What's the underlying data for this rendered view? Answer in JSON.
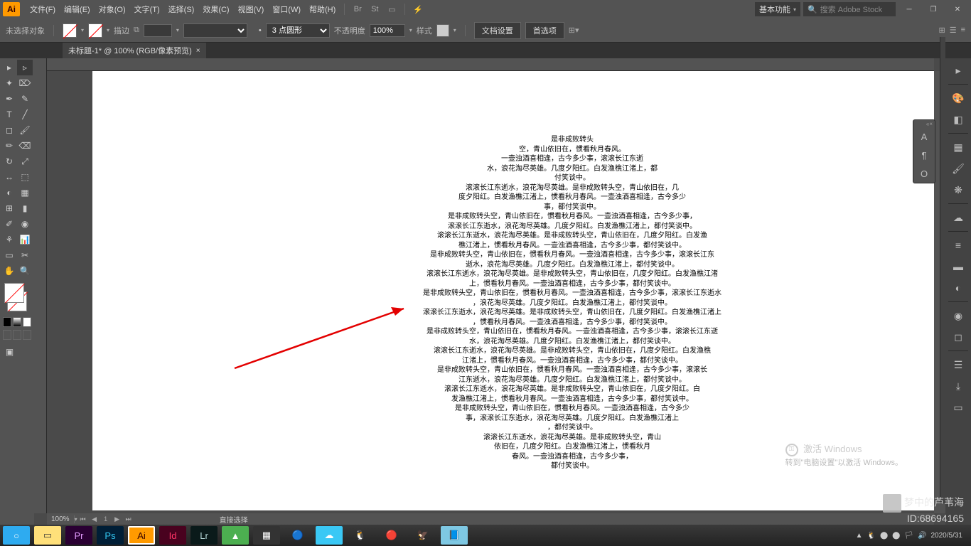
{
  "menubar": {
    "items": [
      "文件(F)",
      "编辑(E)",
      "对象(O)",
      "文字(T)",
      "选择(S)",
      "效果(C)",
      "视图(V)",
      "窗口(W)",
      "帮助(H)"
    ],
    "workspace": "基本功能",
    "search_placeholder": "搜索 Adobe Stock"
  },
  "controlbar": {
    "no_selection": "未选择对象",
    "stroke_label": "描边",
    "stroke_value": "",
    "point_value": "3 点圆形",
    "opacity_label": "不透明度",
    "opacity_value": "100%",
    "style_label": "样式",
    "doc_setup": "文档设置",
    "prefs": "首选项"
  },
  "tab": {
    "title": "未标题-1* @ 100% (RGB/像素预览)"
  },
  "status": {
    "zoom": "100%",
    "page": "1",
    "tool": "直接选择"
  },
  "activate": {
    "title": "激活 Windows",
    "sub": "转到\"电脑设置\"以激活 Windows。"
  },
  "watermark": {
    "line1": "梦中的芦苇海",
    "line2": "ID:68694165"
  },
  "taskbar": {
    "time": "2020/5/31"
  },
  "text_lines": [
    "是非成败转头",
    "空，青山依旧在，惯看秋月春风。",
    "一壶浊酒喜相逢，古今多少事，滚滚长江东逝",
    "水，浪花淘尽英雄。几度夕阳红。白发渔樵江渚上，都",
    "付笑谈中。",
    "滚滚长江东逝水，浪花淘尽英雄。是非成败转头空，青山依旧在，几",
    "度夕阳红。白发渔樵江渚上，惯看秋月春风。一壶浊酒喜相逢，古今多少",
    "事，都付笑谈中。",
    "是非成败转头空，青山依旧在，惯看秋月春风。一壶浊酒喜相逢，古今多少事，",
    "滚滚长江东逝水，浪花淘尽英雄。几度夕阳红。白发渔樵江渚上，都付笑谈中。",
    "滚滚长江东逝水，浪花淘尽英雄。是非成败转头空，青山依旧在，几度夕阳红。白发渔",
    "樵江渚上，惯看秋月春风。一壶浊酒喜相逢，古今多少事，都付笑谈中。",
    "是非成败转头空，青山依旧在，惯看秋月春风。一壶浊酒喜相逢，古今多少事，滚滚长江东",
    "逝水，浪花淘尽英雄。几度夕阳红。白发渔樵江渚上，都付笑谈中。",
    "滚滚长江东逝水，浪花淘尽英雄。是非成败转头空，青山依旧在，几度夕阳红。白发渔樵江渚",
    "上，惯看秋月春风。一壶浊酒喜相逢，古今多少事，都付笑谈中。",
    "是非成败转头空，青山依旧在，惯看秋月春风。一壶浊酒喜相逢，古今多少事，滚滚长江东逝水",
    "，浪花淘尽英雄。几度夕阳红。白发渔樵江渚上，都付笑谈中。",
    "滚滚长江东逝水，浪花淘尽英雄。是非成败转头空，青山依旧在，几度夕阳红。白发渔樵江渚上",
    "，惯看秋月春风。一壶浊酒喜相逢，古今多少事，都付笑谈中。",
    "是非成败转头空，青山依旧在，惯看秋月春风。一壶浊酒喜相逢，古今多少事，滚滚长江东逝",
    "水，浪花淘尽英雄。几度夕阳红。白发渔樵江渚上，都付笑谈中。",
    "滚滚长江东逝水，浪花淘尽英雄。是非成败转头空，青山依旧在，几度夕阳红。白发渔樵",
    "江渚上，惯看秋月春风。一壶浊酒喜相逢，古今多少事，都付笑谈中。",
    "是非成败转头空，青山依旧在，惯看秋月春风。一壶浊酒喜相逢，古今多少事，滚滚长",
    "江东逝水，浪花淘尽英雄。几度夕阳红。白发渔樵江渚上，都付笑谈中。",
    "滚滚长江东逝水，浪花淘尽英雄。是非成败转头空，青山依旧在，几度夕阳红。白",
    "发渔樵江渚上，惯看秋月春风。一壶浊酒喜相逢，古今多少事，都付笑谈中。",
    "是非成败转头空，青山依旧在，惯看秋月春风。一壶浊酒喜相逢，古今多少",
    "事，滚滚长江东逝水，浪花淘尽英雄。几度夕阳红。白发渔樵江渚上",
    "，都付笑谈中。",
    "滚滚长江东逝水，浪花淘尽英雄。是非成败转头空，青山",
    "依旧在，几度夕阳红。白发渔樵江渚上，惯看秋月",
    "春风。一壶浊酒喜相逢，古今多少事，",
    "都付笑谈中。"
  ]
}
